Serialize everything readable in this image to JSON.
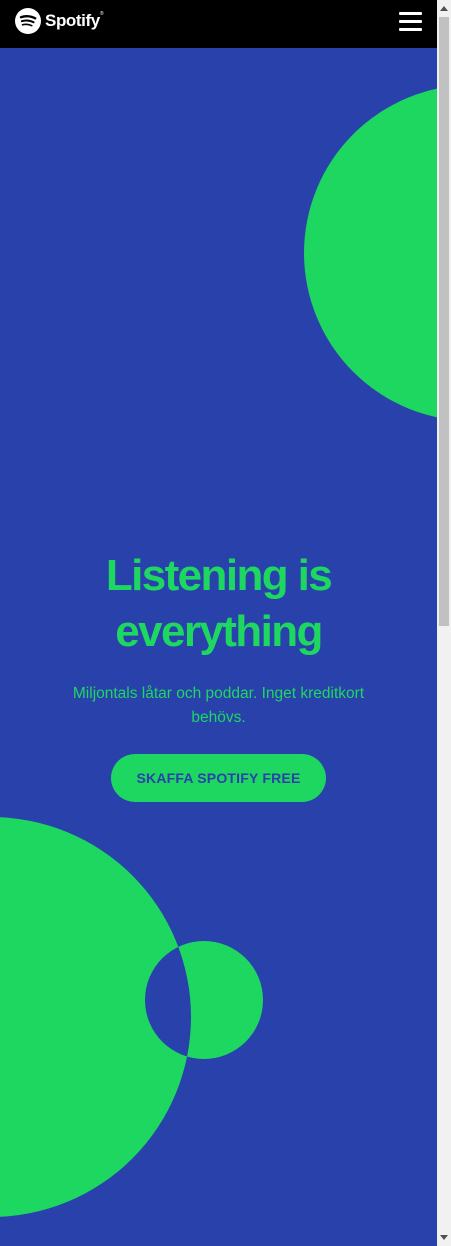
{
  "header": {
    "brand_name": "Spotify",
    "brand_reg_mark": "®",
    "menu_icon": "hamburger-menu-icon"
  },
  "hero": {
    "headline_line1": "Listening is",
    "headline_line2": "everything",
    "subtext": "Miljontals låtar och poddar. Inget kreditkort behövs.",
    "cta_label": "SKAFFA SPOTIFY FREE"
  },
  "colors": {
    "background": "#2941ab",
    "accent_green": "#1ed760",
    "header_bg": "#000000"
  }
}
